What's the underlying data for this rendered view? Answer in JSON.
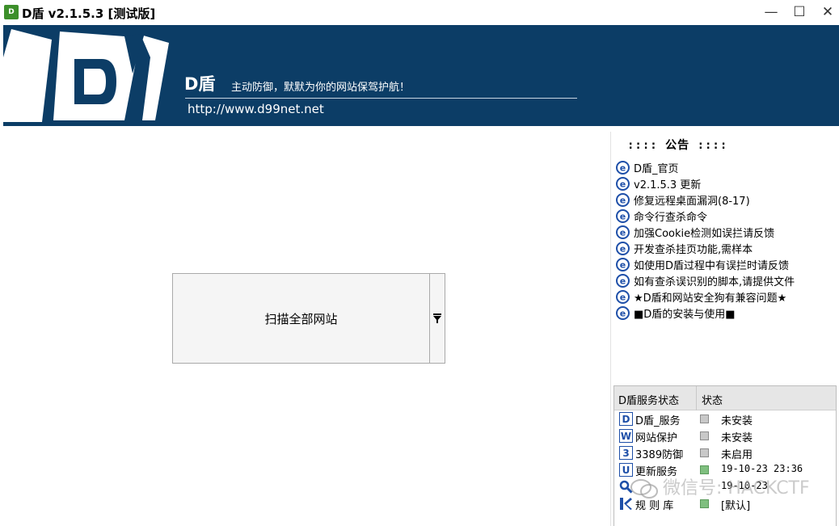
{
  "window": {
    "icon_text": "D",
    "title": "D盾 v2.1.5.3 [测试版]",
    "min_glyph": "—",
    "max_glyph": "☐",
    "close_glyph": "✕"
  },
  "banner": {
    "logo_icon": "d-shield-logo",
    "brand": "D盾",
    "slogan": "主动防御，默默为你的网站保驾护航！",
    "url": "http://www.d99net.net"
  },
  "scan": {
    "label": "扫描全部网站",
    "dropdown_icon": "dropdown-arrow-icon"
  },
  "notice": {
    "title": ":::: 公告 ::::",
    "items": [
      {
        "label": "D盾_官页",
        "icon": "ie-icon"
      },
      {
        "label": "v2.1.5.3 更新",
        "icon": "ie-icon"
      },
      {
        "label": "修复远程桌面漏洞(8-17)",
        "icon": "ie-icon"
      },
      {
        "label": "命令行查杀命令",
        "icon": "ie-icon"
      },
      {
        "label": "加强Cookie检测如误拦请反馈",
        "icon": "ie-icon"
      },
      {
        "label": "开发查杀挂页功能,需样本",
        "icon": "ie-icon"
      },
      {
        "label": "如使用D盾过程中有误拦时请反馈",
        "icon": "ie-icon"
      },
      {
        "label": "如有查杀误识别的脚本,请提供文件",
        "icon": "ie-icon"
      },
      {
        "label": "★D盾和网站安全狗有兼容问题★",
        "icon": "ie-icon"
      },
      {
        "label": "■D盾的安装与使用■",
        "icon": "ie-icon"
      }
    ]
  },
  "status": {
    "col_service": "D盾服务状态",
    "col_state": "状态",
    "rows": [
      {
        "name": "D盾_服务",
        "state": "未安装",
        "icon": "D",
        "icon_name": "service-d-icon",
        "ok": false
      },
      {
        "name": "网站保护",
        "state": "未安装",
        "icon": "W",
        "icon_name": "web-protect-icon",
        "ok": false
      },
      {
        "name": "3389防御",
        "state": "未启用",
        "icon": "3",
        "icon_name": "rdp-defense-icon",
        "ok": false
      },
      {
        "name": "更新服务",
        "state": "19-10-23 23:36",
        "icon": "U",
        "icon_name": "update-icon",
        "ok": true
      },
      {
        "name": "",
        "state": "19-10-23",
        "icon": "Q",
        "icon_name": "search-icon",
        "ok": false
      },
      {
        "name": "规 则 库",
        "state": "[默认]",
        "icon": "K",
        "icon_name": "rules-icon",
        "ok": true
      }
    ]
  },
  "watermark": {
    "text": "微信号: HACKCTF"
  },
  "colors": {
    "banner": "#0c3d66",
    "icon_blue": "#1e4fa8",
    "status_ok": "#7fbf7f",
    "status_off": "#c8c8c8"
  }
}
